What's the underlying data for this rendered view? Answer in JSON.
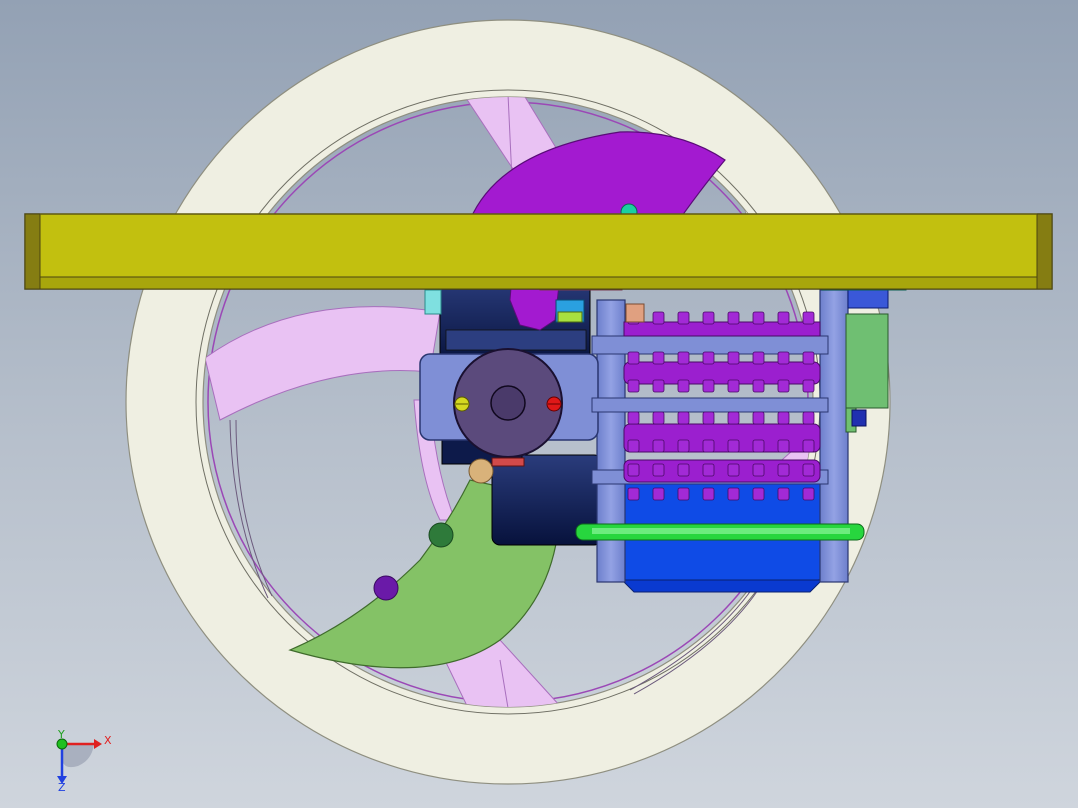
{
  "viewport": {
    "background_top": "#93a1b4",
    "background_bottom": "#cfd5dd"
  },
  "model": {
    "colors": {
      "ring": "#efefe2",
      "bar": "#c2c00f",
      "bar_edge": "#857d12",
      "drum": "#9b1fcf",
      "frame": "#7f8fd6",
      "motor": "#1a2a6a",
      "motor_cap": "#5b4a7c",
      "green_plate": "#84c266",
      "lavender": "#e9c2f3",
      "magenta_sector": "#a31ad0",
      "axle": "#27d63e",
      "blue_plate": "#0f4be6"
    }
  },
  "triad": {
    "x_label": "X",
    "y_label": "Y",
    "z_label": "Z",
    "x_color": "#e02020",
    "y_color": "#20c020",
    "z_color": "#2040e0"
  }
}
